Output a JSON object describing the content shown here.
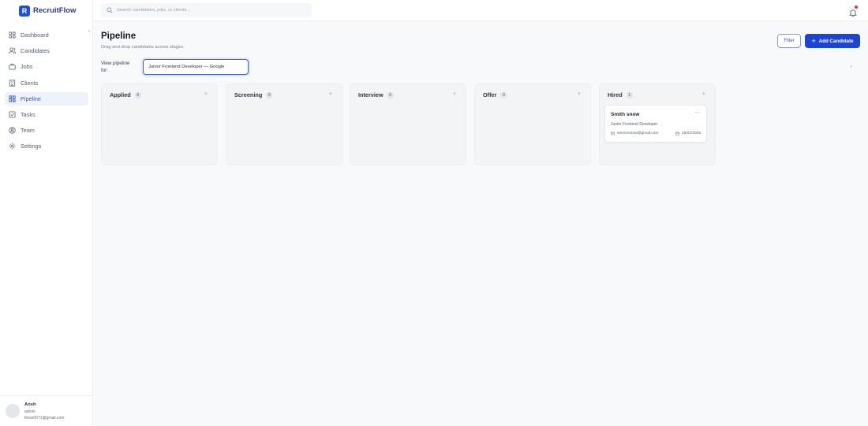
{
  "app": {
    "logo_letter": "R",
    "name": "RecruitFlow"
  },
  "search": {
    "placeholder": "Search candidates, jobs, or clients..."
  },
  "sidebar": {
    "items": [
      {
        "label": "Dashboard",
        "icon": "grid-icon"
      },
      {
        "label": "Candidates",
        "icon": "users-icon"
      },
      {
        "label": "Jobs",
        "icon": "briefcase-icon"
      },
      {
        "label": "Clients",
        "icon": "building-icon"
      },
      {
        "label": "Pipeline",
        "icon": "kanban-icon",
        "active": true
      },
      {
        "label": "Tasks",
        "icon": "checkbox-icon"
      },
      {
        "label": "Team",
        "icon": "team-icon"
      },
      {
        "label": "Settings",
        "icon": "gear-icon"
      }
    ],
    "user": {
      "name": "Ansh",
      "role": "admin",
      "email": "thear0071@gmail.com"
    }
  },
  "header": {
    "title": "Pipeline",
    "subtitle": "Drag and drop candidates across stages.",
    "filter_label": "Filter",
    "add_label": "Add Candidate"
  },
  "pipeline_select": {
    "label": "View pipeline for:",
    "value": "Junior Frontend Developer — Google"
  },
  "columns": [
    {
      "title": "Applied",
      "count": "0"
    },
    {
      "title": "Screening",
      "count": "0"
    },
    {
      "title": "Interview",
      "count": "0"
    },
    {
      "title": "Offer",
      "count": "0"
    },
    {
      "title": "Hired",
      "count": "1"
    }
  ],
  "cards": [
    {
      "stage": "Hired",
      "name": "Smith snow",
      "role": "Junior Frontend Developer",
      "email": "smmmnsow@gmail.com",
      "date": "25/01/2026"
    }
  ],
  "colors": {
    "accent": "#1d45d4",
    "brand": "#1f4fd8",
    "notification": "#e0362c"
  }
}
